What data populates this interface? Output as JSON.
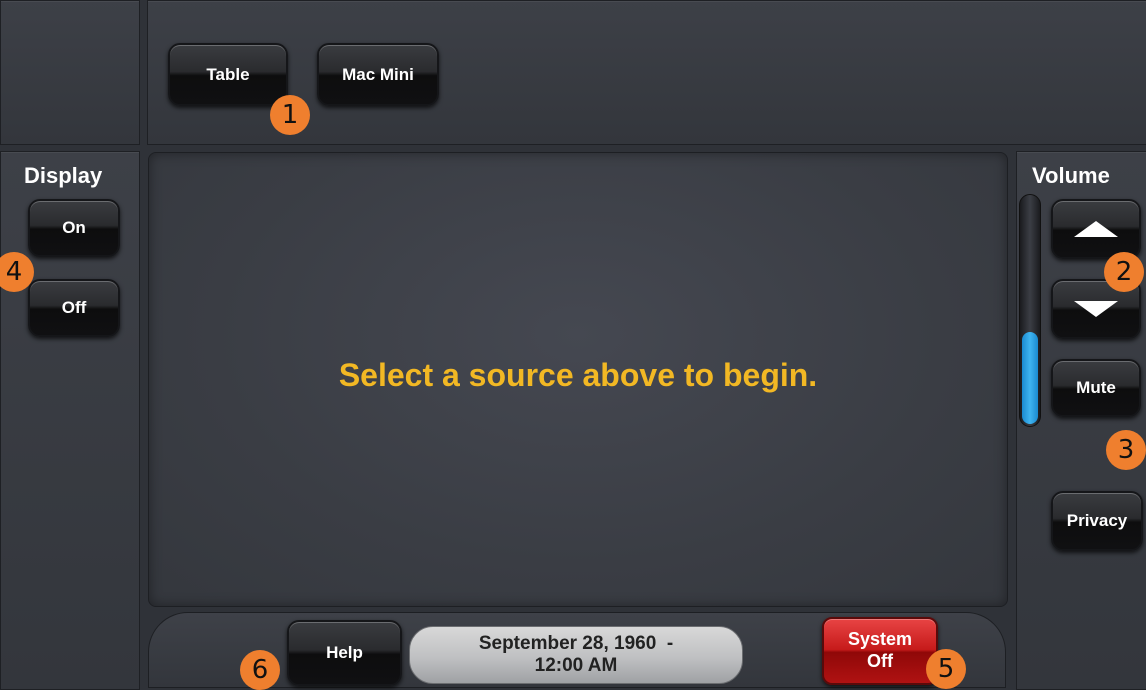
{
  "sources": {
    "table_label": "Table",
    "mac_mini_label": "Mac Mini"
  },
  "display": {
    "title": "Display",
    "on_label": "On",
    "off_label": "Off"
  },
  "volume": {
    "title": "Volume",
    "level": 0.4,
    "mute_label": "Mute",
    "up_icon": "arrow-up-icon",
    "down_icon": "arrow-down-icon"
  },
  "privacy_label": "Privacy",
  "main": {
    "message": "Select a source above to begin."
  },
  "footer": {
    "help_label": "Help",
    "date_line1": "September 28, 1960  -",
    "date_line2": "12:00 AM",
    "system_off_line1": "System",
    "system_off_line2": "Off"
  },
  "badges": {
    "b1": "1",
    "b2": "2",
    "b3": "3",
    "b4": "4",
    "b5": "5",
    "b6": "6"
  },
  "colors": {
    "message": "#f2b824",
    "volume_fill": "#29a3e6",
    "system_off": "#d21a1a",
    "badge": "#ef7f2e"
  }
}
